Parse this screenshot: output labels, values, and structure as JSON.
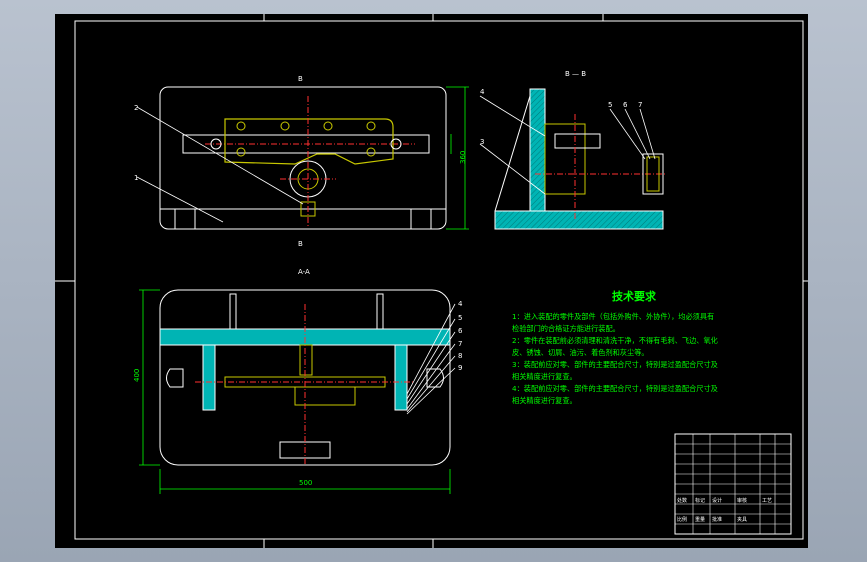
{
  "views": {
    "top_section_label": "B — B",
    "side_section_label": "B — B",
    "bottom_section_label": "A-A",
    "top_view_marker_top": "B",
    "top_view_marker_bottom": "B",
    "part_numbers_top": [
      "2",
      "1"
    ],
    "part_numbers_side": [
      "4",
      "3",
      "5",
      "6",
      "7"
    ],
    "part_numbers_bottom": [
      "4",
      "5",
      "6",
      "7",
      "8",
      "9"
    ],
    "dimension_width": "500",
    "dimension_height": "360",
    "dimension_left": "400"
  },
  "technical_requirements": {
    "title": "技术要求",
    "items": [
      "1：进入装配的零件及部件（包括外购件、外协件），均必须具有",
      "检验部门的合格证方能进行装配。",
      "2：零件在装配前必须清理和清洗干净，不得有毛刺、飞边、氧化",
      "皮、锈蚀、切屑、油污、着色剂和灰尘等。",
      "3：装配前应对零、部件的主要配合尺寸，特别是过盈配合尺寸及",
      "相关精度进行复查。",
      "4：装配前应对零、部件的主要配合尺寸，特别是过盈配合尺寸及",
      "相关精度进行复查。"
    ]
  },
  "title_block": {
    "cells": [
      "处数",
      "标记",
      "设计",
      "审核",
      "工艺",
      "比例",
      "重量",
      "批准",
      "夹具"
    ]
  },
  "colors": {
    "outline": "#ffffff",
    "section_fill": "#00b4b4",
    "part_fill": "#c8c800",
    "center_line": "#ff3030",
    "dimension": "#00ff00",
    "note_text": "#00ff00"
  }
}
